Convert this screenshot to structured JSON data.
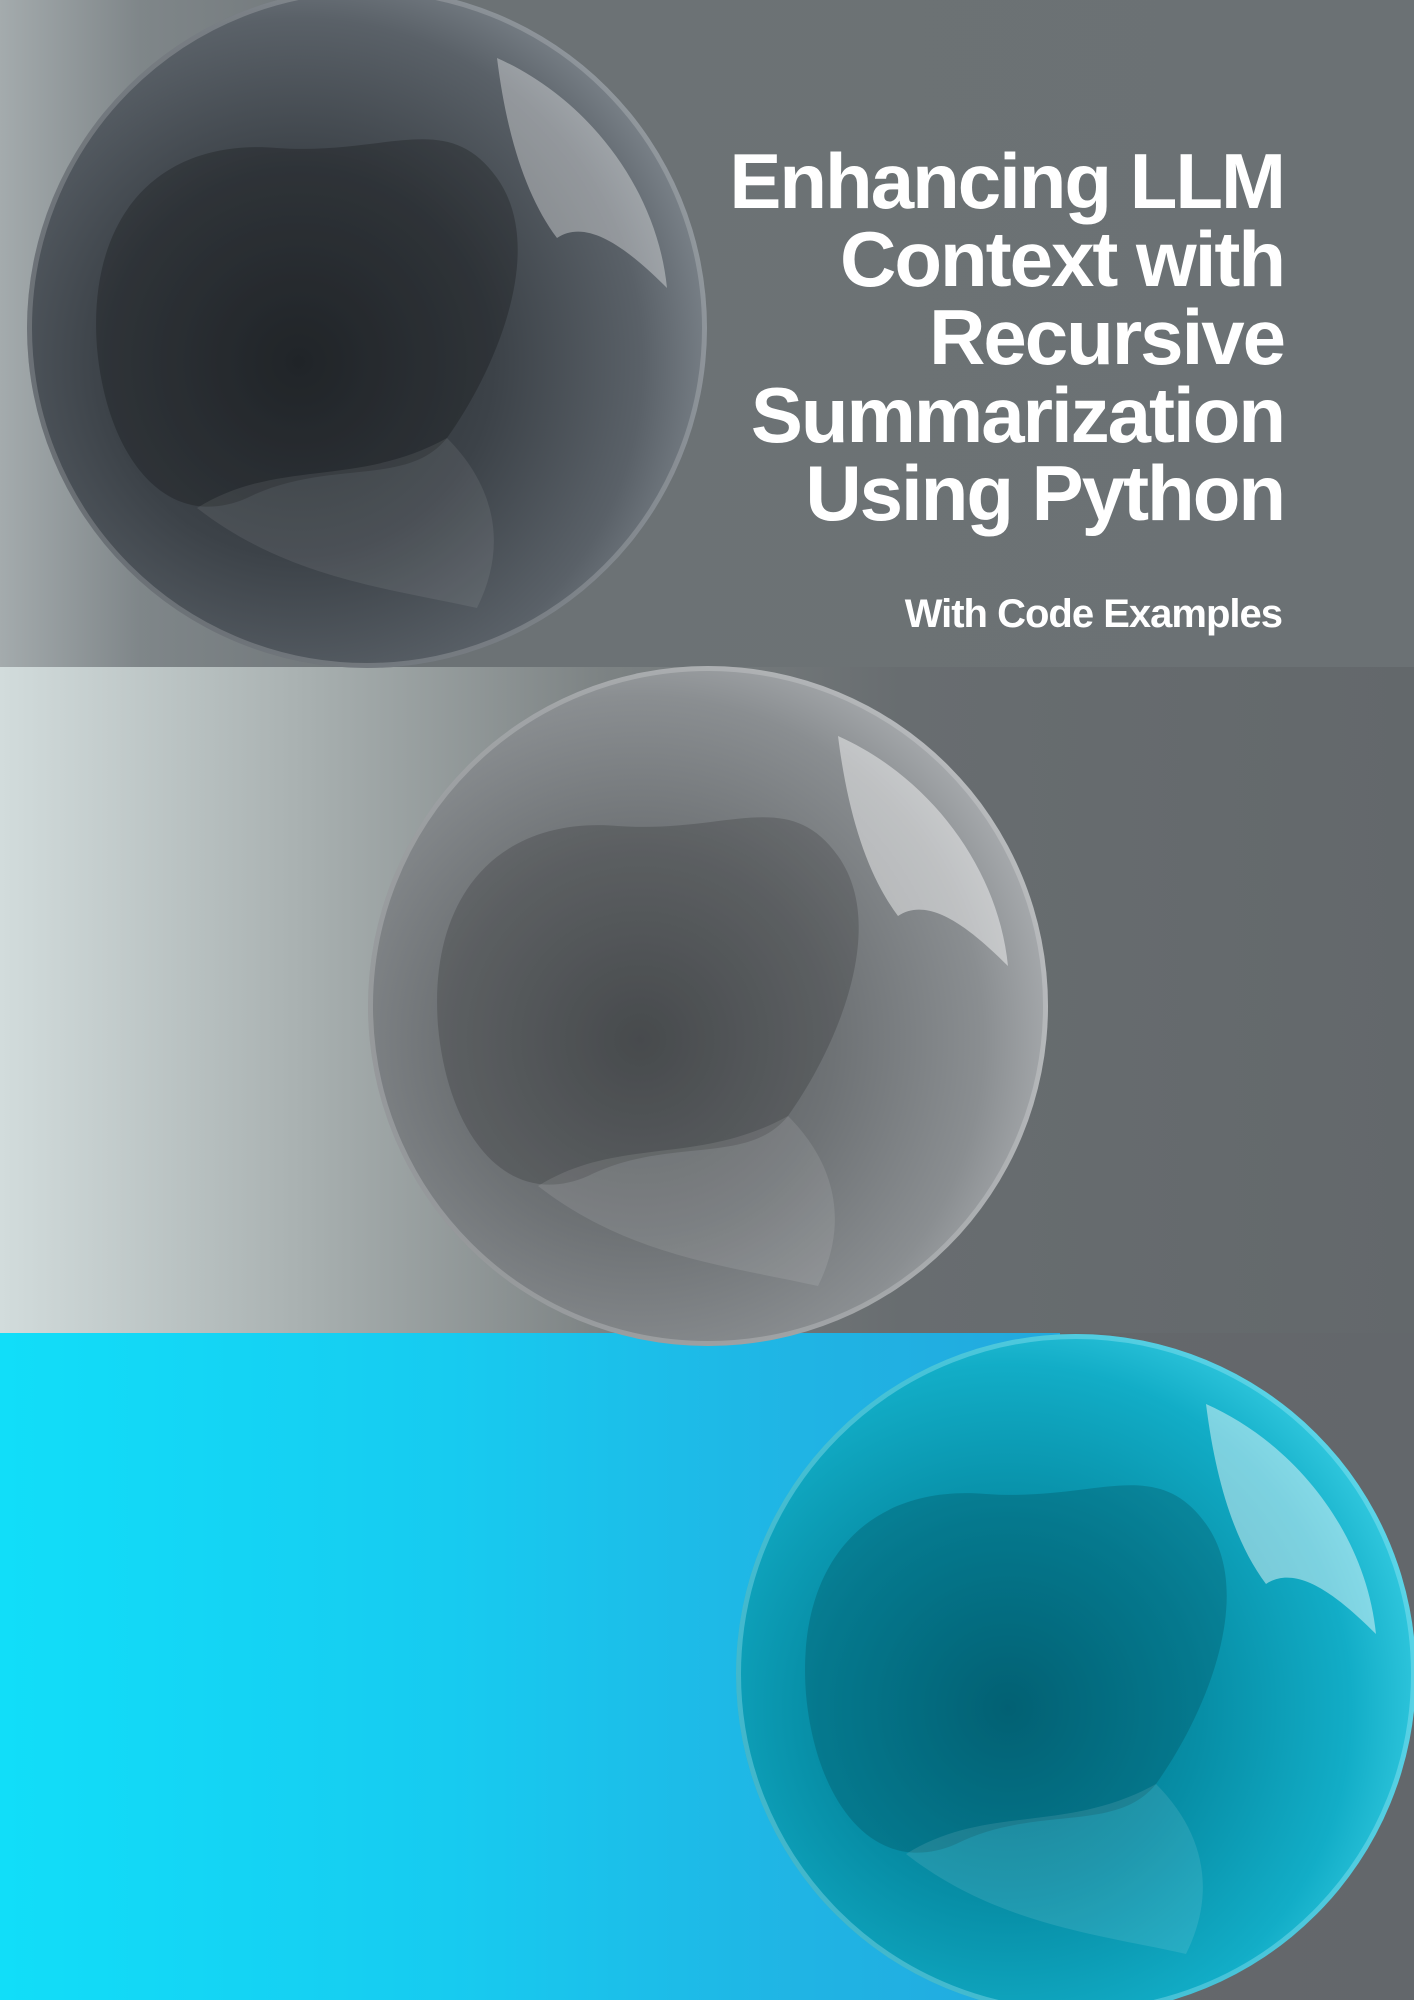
{
  "cover": {
    "title_lines": [
      "Enhancing LLM",
      "Context with",
      "Recursive",
      "Summarization",
      "Using Python"
    ],
    "subtitle": "With Code Examples"
  },
  "colors": {
    "text": "#ffffff",
    "accent_cyan": "#11def9",
    "sphere_dark": "#3c4248",
    "sphere_light": "#8a8e91",
    "sphere_cyan": "#12adc7"
  }
}
